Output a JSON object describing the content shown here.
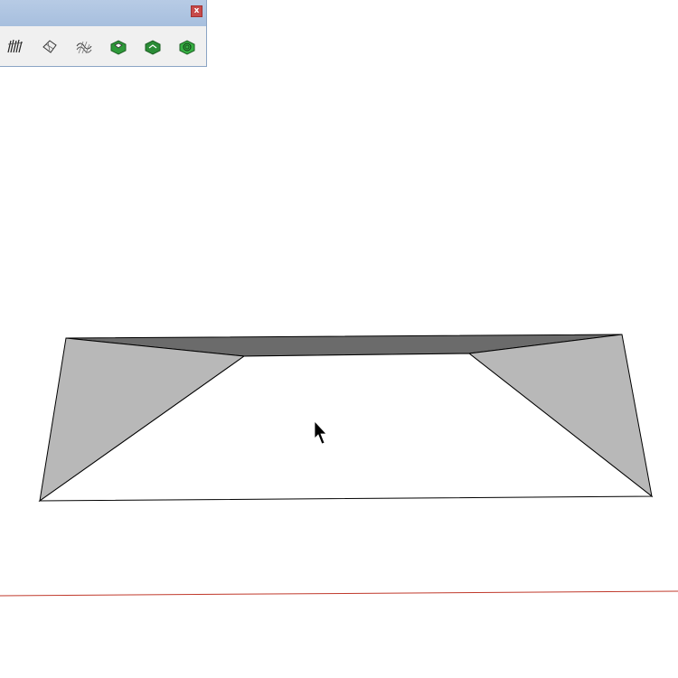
{
  "toolbar": {
    "close_label": "x",
    "tools": [
      {
        "name": "from-contours-icon"
      },
      {
        "name": "from-scratch-icon"
      },
      {
        "name": "smoove-icon"
      },
      {
        "name": "stamp-icon"
      },
      {
        "name": "drape-icon"
      },
      {
        "name": "add-detail-icon"
      }
    ]
  },
  "scene": {
    "colors": {
      "background": "#ffffff",
      "face_light": "#b8b8b8",
      "face_dark": "#6b6b6b",
      "face_top": "#ffffff",
      "edge": "#000000",
      "red_axis": "#c0392b"
    }
  }
}
